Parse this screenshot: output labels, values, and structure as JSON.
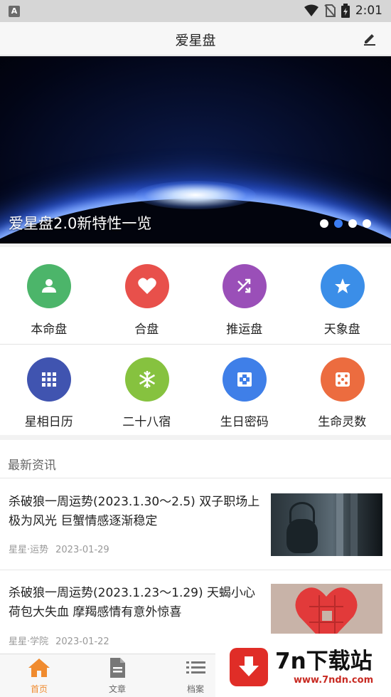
{
  "status_bar": {
    "time": "2:01"
  },
  "app_bar": {
    "title": "爱星盘"
  },
  "banner": {
    "caption": "爱星盘2.0新特性一览",
    "dot_count": 4,
    "active_dot": 2
  },
  "menu_row1": [
    {
      "label": "本命盘",
      "icon": "person-icon",
      "color": "#4cb56a"
    },
    {
      "label": "合盘",
      "icon": "heart-icon",
      "color": "#e8504b"
    },
    {
      "label": "推运盘",
      "icon": "shuffle-icon",
      "color": "#9a4fb8"
    },
    {
      "label": "天象盘",
      "icon": "star-icon",
      "color": "#3b8ee8"
    }
  ],
  "menu_row2": [
    {
      "label": "星相日历",
      "icon": "grid-icon",
      "color": "#4054b0"
    },
    {
      "label": "二十八宿",
      "icon": "snowflake-icon",
      "color": "#86c23f"
    },
    {
      "label": "生日密码",
      "icon": "cross-box-icon",
      "color": "#3f7fe8"
    },
    {
      "label": "生命灵数",
      "icon": "dice-icon",
      "color": "#ec6c3f"
    }
  ],
  "news": {
    "section_title": "最新资讯",
    "articles": [
      {
        "headline": "杀破狼一周运势(2023.1.30～2.5) 双子职场上极为风光 巨蟹情感逐渐稳定",
        "source": "星星·运势",
        "date": "2023-01-29",
        "thumb": "teapot"
      },
      {
        "headline": "杀破狼一周运势(2023.1.23～1.29) 天蝎小心荷包大失血 摩羯感情有意外惊喜",
        "source": "星星·学院",
        "date": "2023-01-22",
        "thumb": "puzzle"
      }
    ]
  },
  "tab_bar": {
    "tabs": [
      {
        "label": "首页",
        "icon": "home-icon",
        "active": true
      },
      {
        "label": "文章",
        "icon": "document-icon",
        "active": false
      },
      {
        "label": "档案",
        "icon": "list-icon",
        "active": false
      }
    ]
  },
  "watermark": {
    "brand": "7n下载站",
    "site": "www.7ndn.com"
  },
  "colors": {
    "accent": "#f08b2f",
    "active_dot": "#3c7ef3"
  }
}
